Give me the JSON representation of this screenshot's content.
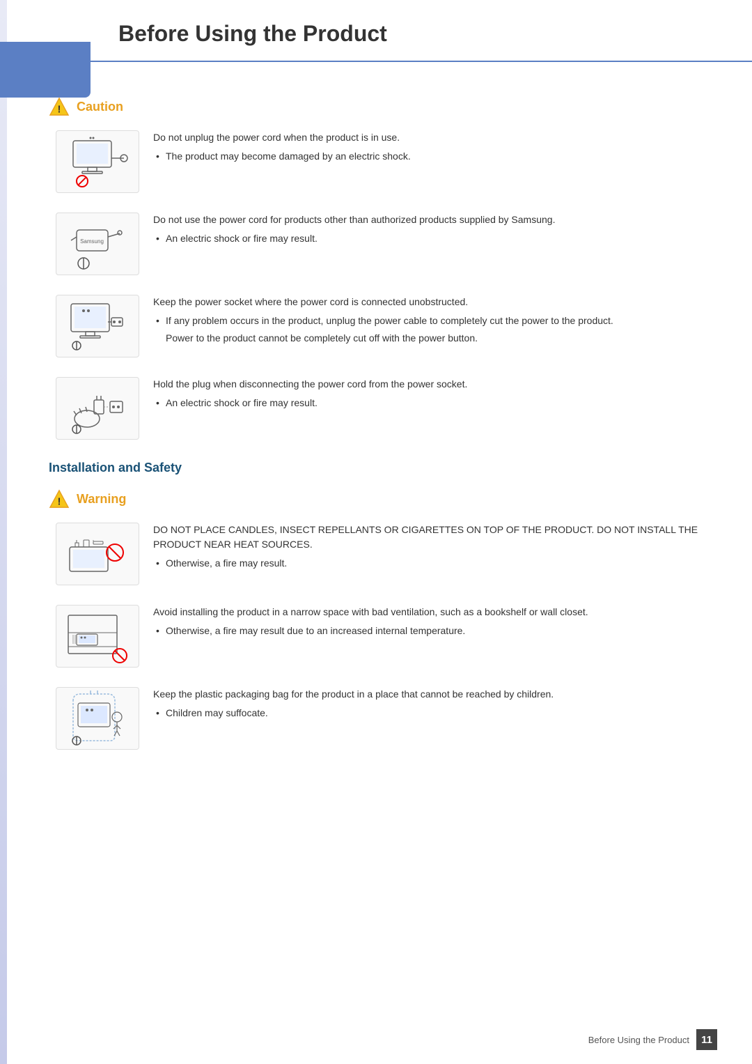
{
  "page": {
    "title": "Before Using the Product",
    "footer_text": "Before Using the Product",
    "page_number": "11"
  },
  "caution_section": {
    "label": "Caution",
    "items": [
      {
        "id": "caution-1",
        "main_text": "Do not unplug the power cord when the product is in use.",
        "bullets": [
          "The product may become damaged by an electric shock."
        ],
        "sub_notes": []
      },
      {
        "id": "caution-2",
        "main_text": "Do not use the power cord for products other than authorized products supplied by Samsung.",
        "bullets": [
          "An electric shock or fire may result."
        ],
        "sub_notes": []
      },
      {
        "id": "caution-3",
        "main_text": "Keep the power socket where the power cord is connected unobstructed.",
        "bullets": [
          "If any problem occurs in the product, unplug the power cable to completely cut the power to the product."
        ],
        "sub_notes": [
          "Power to the product cannot be completely cut off with the power button."
        ]
      },
      {
        "id": "caution-4",
        "main_text": "Hold the plug when disconnecting the power cord from the power socket.",
        "bullets": [
          "An electric shock or fire may result."
        ],
        "sub_notes": []
      }
    ]
  },
  "installation_section": {
    "label": "Installation and Safety"
  },
  "warning_section": {
    "label": "Warning",
    "items": [
      {
        "id": "warning-1",
        "main_text": "DO NOT PLACE CANDLES, INSECT REPELLANTS OR CIGARETTES ON TOP OF THE PRODUCT. DO NOT INSTALL THE PRODUCT NEAR HEAT SOURCES.",
        "bullets": [
          "Otherwise, a fire may result."
        ],
        "sub_notes": []
      },
      {
        "id": "warning-2",
        "main_text": "Avoid installing the product in a narrow space with bad ventilation, such as a bookshelf or wall closet.",
        "bullets": [
          "Otherwise, a fire may result due to an increased internal temperature."
        ],
        "sub_notes": []
      },
      {
        "id": "warning-3",
        "main_text": "Keep the plastic packaging bag for the product in a place that cannot be reached by children.",
        "bullets": [
          "Children may suffocate."
        ],
        "sub_notes": []
      }
    ]
  }
}
